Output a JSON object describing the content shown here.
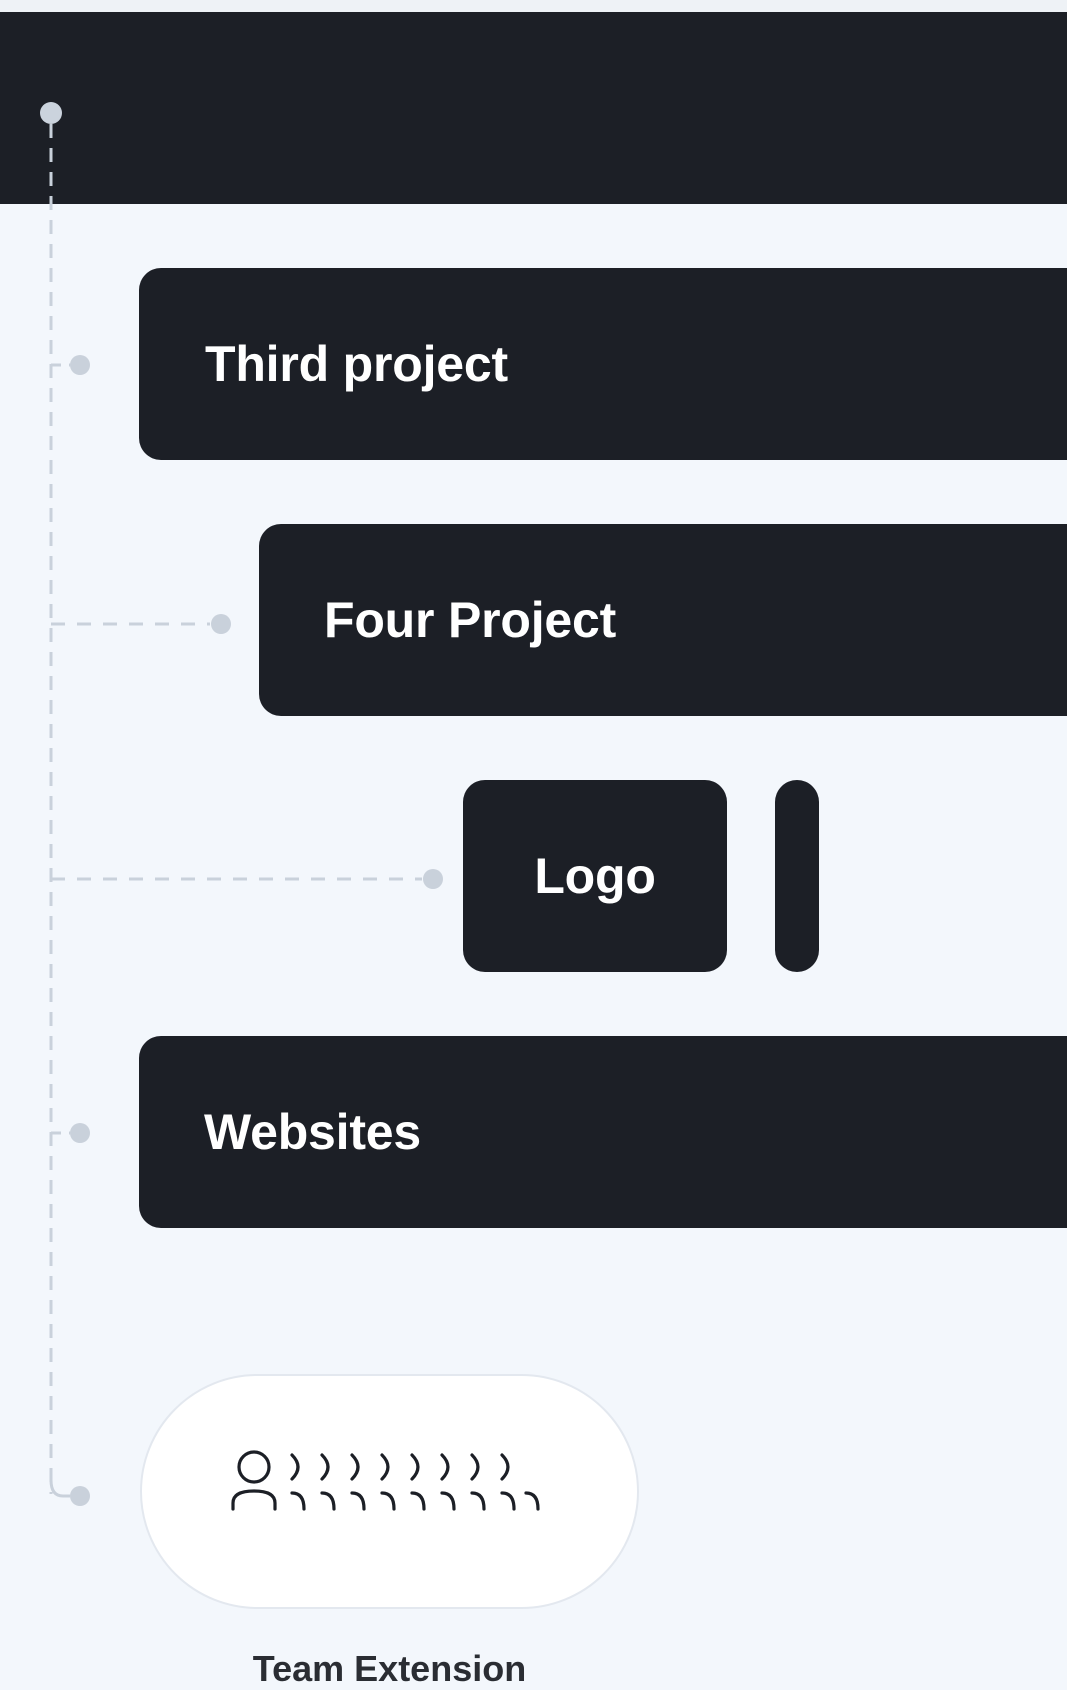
{
  "timeline": {
    "items": [
      {
        "label": "Third project"
      },
      {
        "label": "Four Project"
      },
      {
        "label": "Logo"
      },
      {
        "label": "Websites"
      }
    ],
    "team": {
      "label": "Team Extension",
      "icon": "team-extension-people-icon"
    }
  },
  "colors": {
    "background": "#F3F7FC",
    "bar": "#1C1F26",
    "bar_text": "#FFFFFF",
    "connector": "#C9D1DB",
    "pill_border": "#E3E8EF"
  }
}
